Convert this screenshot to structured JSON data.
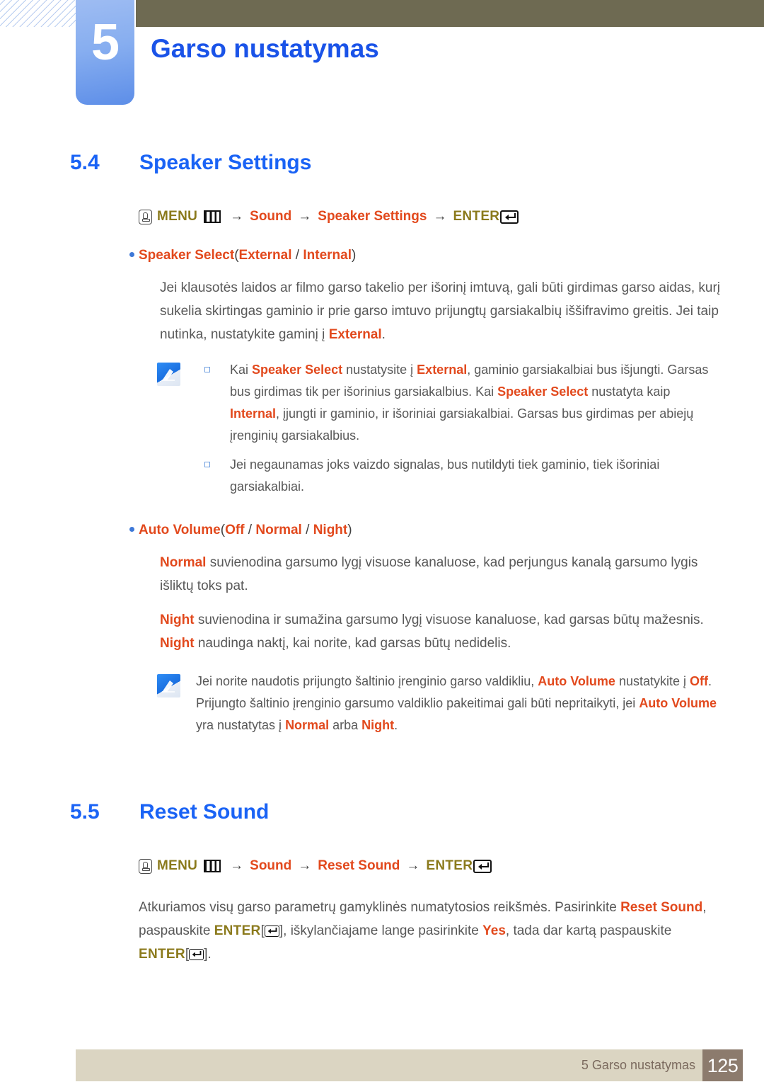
{
  "header": {
    "chapter_number": "5",
    "chapter_title": "Garso nustatymas",
    "accent_blue": "#1a53e8",
    "olive_bar": "#6e6a52"
  },
  "sections": [
    {
      "number": "5.4",
      "title": "Speaker Settings",
      "menu_path": {
        "hand_icon": "hand-press-icon",
        "menu_label": "MENU",
        "menu_bars_icon": "menu-bars-icon",
        "arrow": "→",
        "steps": [
          "Sound",
          "Speaker Settings"
        ],
        "enter_label": "ENTER",
        "enter_icon": "enter-return-icon"
      },
      "bullets": [
        {
          "title": "Speaker Select",
          "options_open": "(",
          "options": [
            "External",
            "Internal"
          ],
          "options_sep": " / ",
          "options_close": ")",
          "paragraphs": [
            {
              "runs": [
                {
                  "t": "Jei klausotės laidos ar filmo garso takelio per išorinį imtuvą, gali būti girdimas garso aidas, kurį sukelia skirtingas gaminio ir prie garso imtuvo prijungtų garsiakalbių iššifravimo greitis. Jei taip nutinka, nustatykite gaminį į ",
                  "k": false
                },
                {
                  "t": "External",
                  "k": true
                },
                {
                  "t": ".",
                  "k": false
                }
              ]
            }
          ],
          "note": {
            "icon": "note-pencil-icon",
            "lines": [
              {
                "bullet": true,
                "runs": [
                  {
                    "t": "Kai ",
                    "k": false
                  },
                  {
                    "t": "Speaker Select",
                    "k": true
                  },
                  {
                    "t": " nustatysite į ",
                    "k": false
                  },
                  {
                    "t": "External",
                    "k": true
                  },
                  {
                    "t": ", gaminio garsiakalbiai bus išjungti. Garsas bus girdimas tik per išorinius garsiakalbius. Kai ",
                    "k": false
                  },
                  {
                    "t": "Speaker Select",
                    "k": true
                  },
                  {
                    "t": " nustatyta kaip ",
                    "k": false
                  },
                  {
                    "t": "Internal",
                    "k": true
                  },
                  {
                    "t": ", įjungti ir gaminio, ir išoriniai garsiakalbiai. Garsas bus girdimas per abiejų įrenginių garsiakalbius.",
                    "k": false
                  }
                ]
              },
              {
                "bullet": true,
                "runs": [
                  {
                    "t": "Jei negaunamas joks vaizdo signalas, bus nutildyti tiek gaminio, tiek išoriniai garsiakalbiai.",
                    "k": false
                  }
                ]
              }
            ]
          }
        },
        {
          "title": "Auto Volume",
          "options_open": "(",
          "options": [
            "Off",
            "Normal",
            "Night"
          ],
          "options_sep": " / ",
          "options_close": ")",
          "paragraphs": [
            {
              "runs": [
                {
                  "t": "Normal",
                  "k": true
                },
                {
                  "t": " suvienodina garsumo lygį visuose kanaluose, kad perjungus kanalą garsumo lygis išliktų toks pat.",
                  "k": false
                }
              ]
            },
            {
              "runs": [
                {
                  "t": "Night",
                  "k": true
                },
                {
                  "t": " suvienodina ir sumažina garsumo lygį visuose kanaluose, kad garsas būtų mažesnis. ",
                  "k": false
                },
                {
                  "t": "Night",
                  "k": true
                },
                {
                  "t": " naudinga naktį, kai norite, kad garsas būtų nedidelis.",
                  "k": false
                }
              ]
            }
          ],
          "note": {
            "icon": "note-pencil-icon",
            "lines": [
              {
                "bullet": false,
                "runs": [
                  {
                    "t": "Jei norite naudotis prijungto šaltinio įrenginio garso valdikliu, ",
                    "k": false
                  },
                  {
                    "t": "Auto Volume",
                    "k": true
                  },
                  {
                    "t": " nustatykite į ",
                    "k": false
                  },
                  {
                    "t": "Off",
                    "k": true
                  },
                  {
                    "t": ". Prijungto šaltinio įrenginio garsumo valdiklio pakeitimai gali būti nepritaikyti, jei ",
                    "k": false
                  },
                  {
                    "t": "Auto Volume",
                    "k": true
                  },
                  {
                    "t": " yra nustatytas į ",
                    "k": false
                  },
                  {
                    "t": "Normal",
                    "k": true
                  },
                  {
                    "t": " arba ",
                    "k": false
                  },
                  {
                    "t": "Night",
                    "k": true
                  },
                  {
                    "t": ".",
                    "k": false
                  }
                ]
              }
            ]
          }
        }
      ]
    },
    {
      "number": "5.5",
      "title": "Reset Sound",
      "menu_path": {
        "hand_icon": "hand-press-icon",
        "menu_label": "MENU",
        "menu_bars_icon": "menu-bars-icon",
        "arrow": "→",
        "steps": [
          "Sound",
          "Reset Sound"
        ],
        "enter_label": "ENTER",
        "enter_icon": "enter-return-icon"
      },
      "closing_paragraph": [
        {
          "t": "Atkuriamos visų garso parametrų gamyklinės numatytosios reikšmės. Pasirinkite ",
          "k": 0
        },
        {
          "t": "Reset Sound",
          "k": 1
        },
        {
          "t": ", paspauskite ",
          "k": 0
        },
        {
          "t": "ENTER",
          "k": 2
        },
        {
          "t": "ENTER_ICON",
          "k": 3
        },
        {
          "t": ", iškylančiajame lange pasirinkite ",
          "k": 0
        },
        {
          "t": "Yes",
          "k": 1
        },
        {
          "t": ", tada dar kartą paspauskite ",
          "k": 0
        },
        {
          "t": "ENTER",
          "k": 2
        },
        {
          "t": "ENTER_ICON",
          "k": 3
        },
        {
          "t": ".",
          "k": 0
        }
      ]
    }
  ],
  "footer": {
    "text": "5 Garso nustatymas",
    "page_number": "125",
    "bar_color": "#dbd5c2",
    "page_box_color": "#8c7b6d"
  },
  "colors": {
    "keyword_orange": "#e2491d",
    "keyword_olive": "#8b7a1c",
    "heading_blue": "#1a63f5",
    "body_gray": "#585858"
  }
}
